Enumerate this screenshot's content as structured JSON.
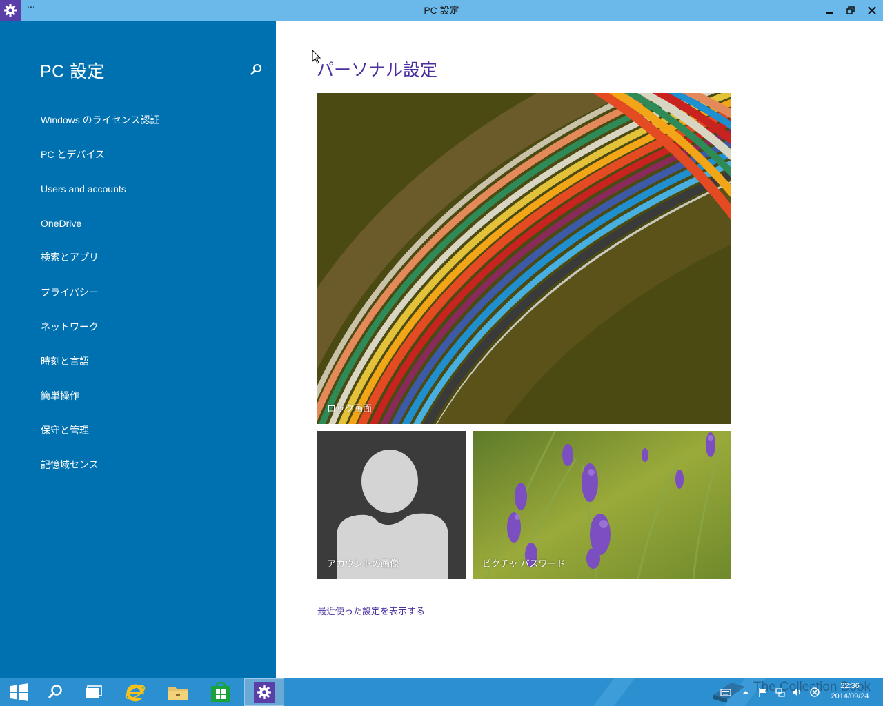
{
  "window": {
    "title": "PC 設定",
    "more_label": "···",
    "title_bar_color": "#6ab9ea",
    "app_icon_color": "#5b3fa8"
  },
  "sidebar": {
    "title": "PC 設定",
    "background": "#0071b0",
    "search_icon": "search-icon",
    "items": [
      {
        "label": "Windows のライセンス認証"
      },
      {
        "label": "PC とデバイス"
      },
      {
        "label": "Users and accounts"
      },
      {
        "label": "OneDrive"
      },
      {
        "label": "検索とアプリ"
      },
      {
        "label": "プライバシー"
      },
      {
        "label": "ネットワーク"
      },
      {
        "label": "時刻と言語"
      },
      {
        "label": "簡単操作"
      },
      {
        "label": "保守と管理"
      },
      {
        "label": "記憶域センス"
      }
    ]
  },
  "main": {
    "heading": "パーソナル設定",
    "heading_color": "#4b2e9f",
    "tiles": {
      "lock_screen": "ロック画面",
      "account_picture": "アカウントの画像",
      "picture_password": "ピクチャ パスワード"
    },
    "recent_link": "最近使った設定を表示する"
  },
  "taskbar": {
    "background": "#2c8fd0",
    "apps": [
      "start-icon",
      "search-icon",
      "task-view-icon",
      "internet-explorer-icon",
      "file-explorer-icon",
      "store-icon",
      "settings-icon"
    ],
    "clock_time": "22:36",
    "clock_date": "2014/09/24",
    "watermark": "The Collection Book"
  }
}
